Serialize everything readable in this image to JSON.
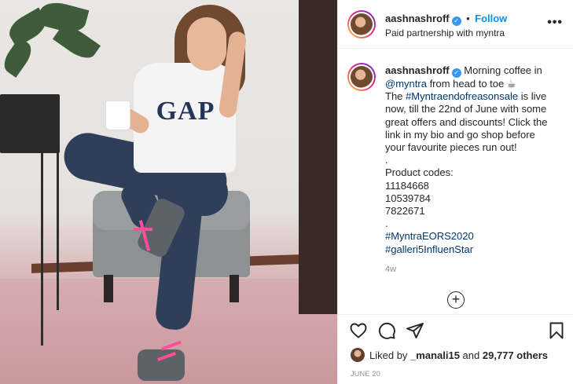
{
  "header": {
    "username": "aashnashroff",
    "separator": "•",
    "follow_label": "Follow",
    "subtitle": "Paid partnership with myntra",
    "more_icon": "more-options-icon"
  },
  "caption": {
    "username": "aashnashroff",
    "line1": "Morning coffee in",
    "mention": "@myntra",
    "line2_rest": "from head to toe ☕",
    "line3_pre": "The",
    "hashtag_sale": "#Myntraendofreasonsale",
    "line3_post": "is live",
    "line4": "now, till the 22nd of June with some",
    "line5": "great offers and discounts! Click the",
    "line6": "link in my bio and go shop before",
    "line7": "your favourite pieces run out!",
    "dot1": ".",
    "codes_label": "Product codes:",
    "codes": [
      "11184668",
      "10539784",
      "7822671"
    ],
    "dot2": ".",
    "hashtag1": "#MyntraEORS2020",
    "hashtag2": "#galleri5InfluenStar",
    "age": "4w"
  },
  "load_more_icon": "plus-circle-icon",
  "actions": {
    "icons": [
      "heart-icon",
      "comment-icon",
      "share-icon",
      "bookmark-icon"
    ]
  },
  "likes": {
    "prefix": "Liked by",
    "user": "_manali15",
    "mid": "and",
    "count": "29,777 others"
  },
  "date": "JUNE 20",
  "photo": {
    "shirt_text": "GAP"
  }
}
